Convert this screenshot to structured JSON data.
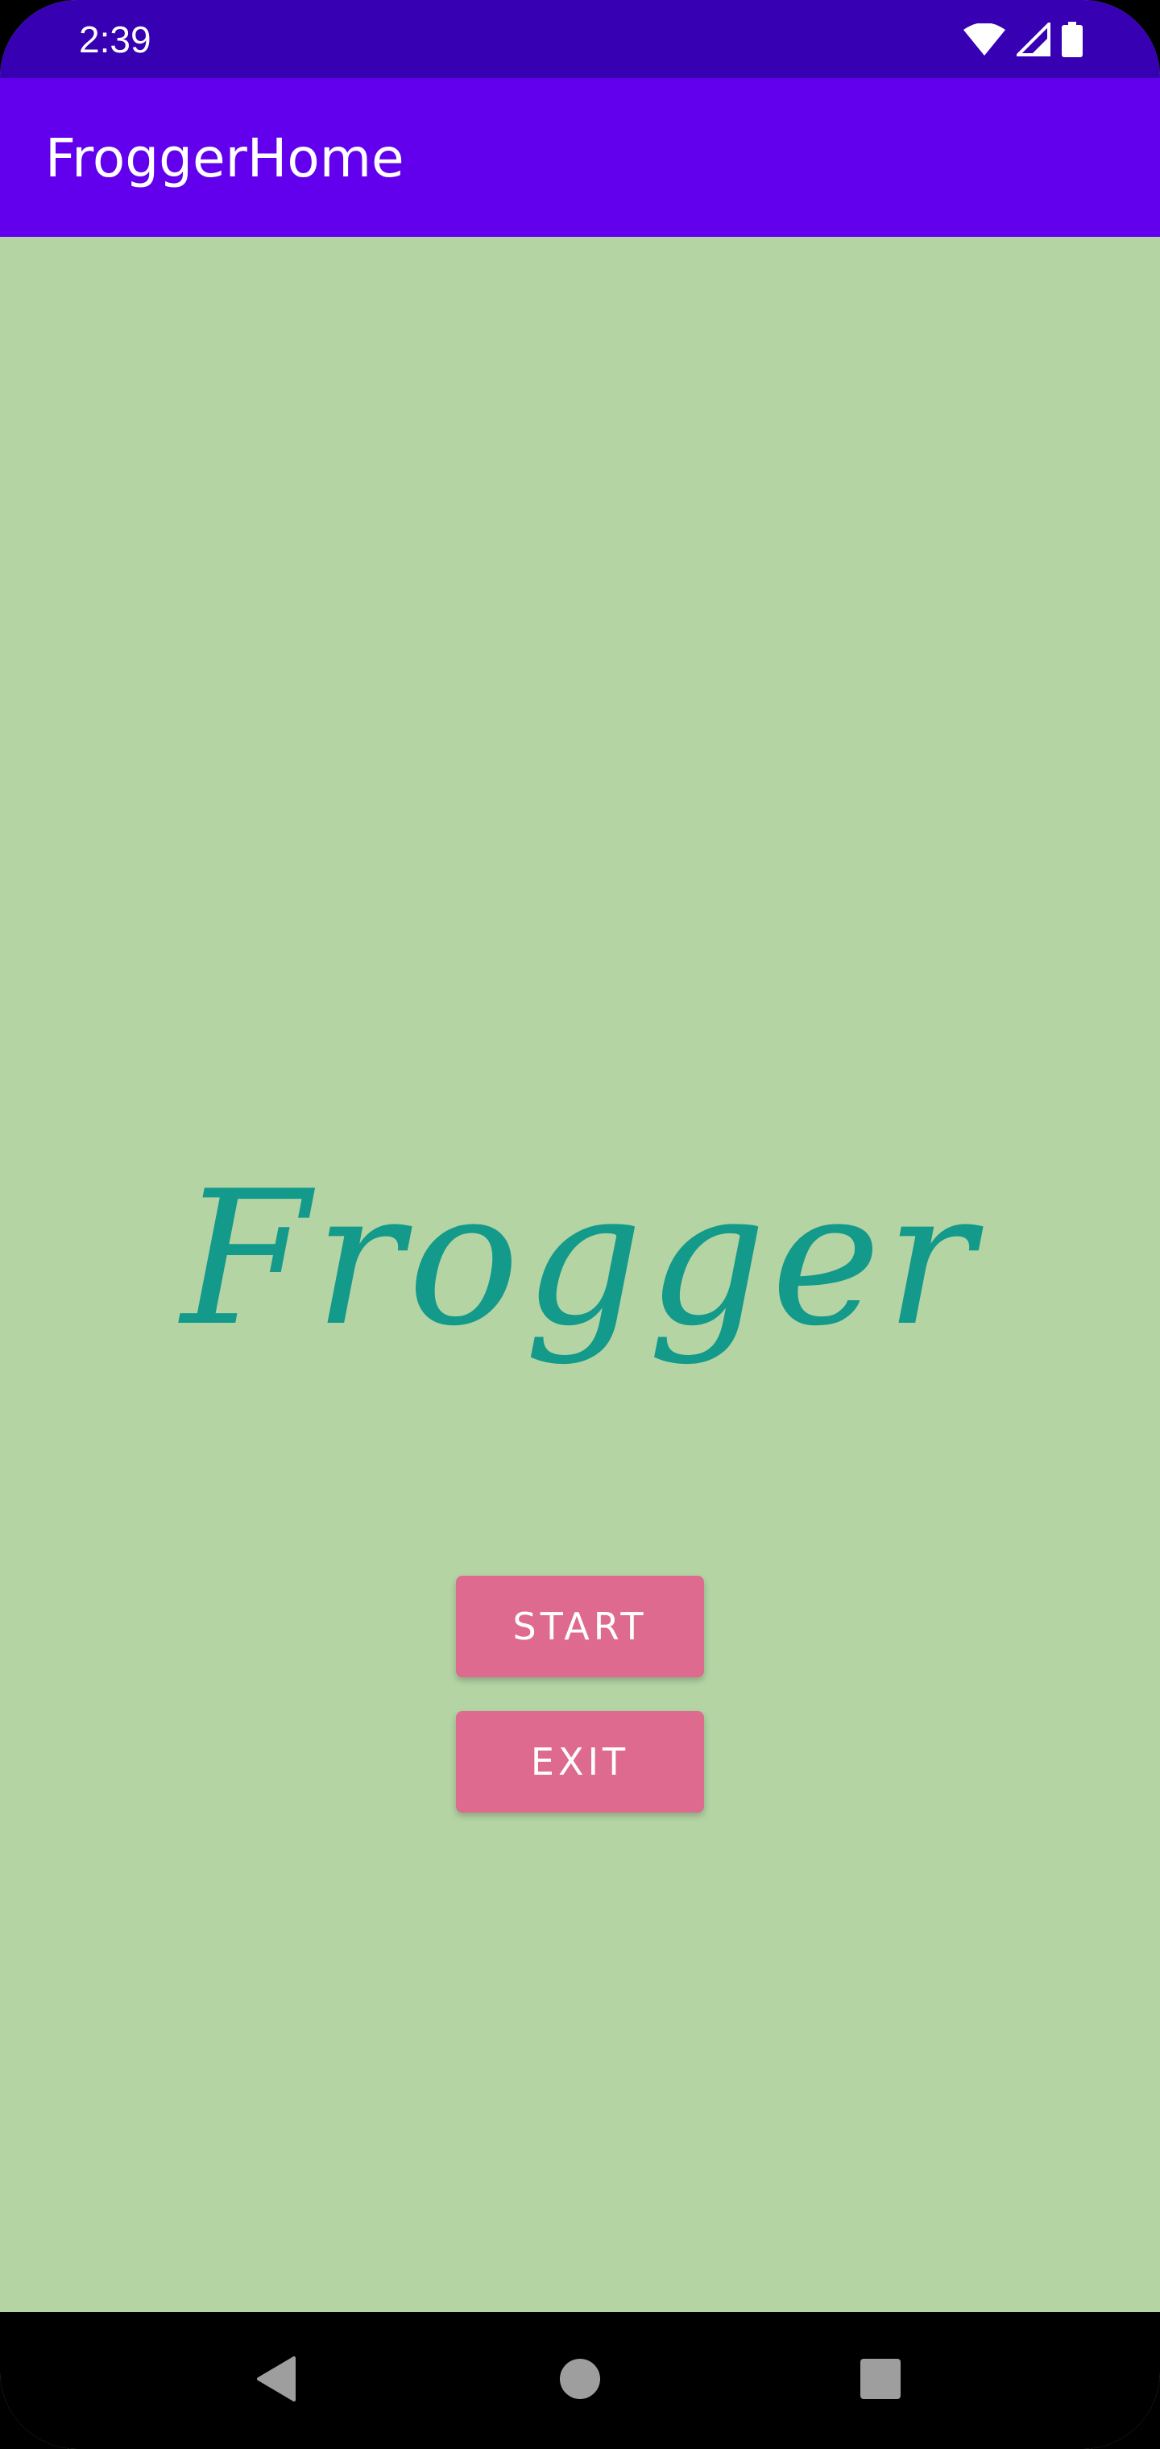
{
  "status_bar": {
    "time": "2:39",
    "icons": [
      "wifi-icon",
      "cell-signal-icon",
      "battery-icon"
    ]
  },
  "app_bar": {
    "title": "FroggerHome",
    "color": "#6200ee"
  },
  "main": {
    "title": "Frogger",
    "title_color": "#139a8a",
    "background_color": "#b4d4a4",
    "buttons": {
      "start_label": "START",
      "exit_label": "EXIT",
      "button_color": "#de6a8f"
    }
  },
  "nav_bar": {
    "icons": [
      "back-icon",
      "home-icon",
      "recents-icon"
    ]
  }
}
